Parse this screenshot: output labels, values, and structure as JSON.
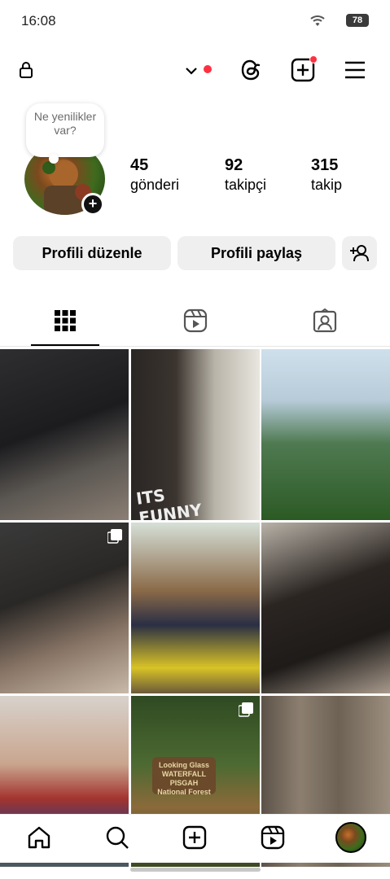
{
  "status_bar": {
    "time": "16:08",
    "battery": "78"
  },
  "top_bar": {
    "icons": [
      "lock-icon",
      "chevron-down-icon",
      "threads-icon",
      "create-icon",
      "menu-icon"
    ],
    "accent": "#ff3040"
  },
  "profile": {
    "note": "Ne yenilikler var?",
    "stats": [
      {
        "value": "45",
        "label": "gönderi"
      },
      {
        "value": "92",
        "label": "takipçi"
      },
      {
        "value": "315",
        "label": "takip"
      }
    ]
  },
  "buttons": {
    "edit": "Profili düzenle",
    "share": "Profili paylaş"
  },
  "tabs": [
    "grid-icon",
    "reels-icon",
    "tagged-icon"
  ],
  "grid": {
    "posts": [
      {
        "kind": "photo",
        "multi": false
      },
      {
        "kind": "photo",
        "multi": false,
        "text": "ITS FUNNY"
      },
      {
        "kind": "photo",
        "multi": false
      },
      {
        "kind": "photo",
        "multi": true
      },
      {
        "kind": "photo",
        "multi": false
      },
      {
        "kind": "photo",
        "multi": false
      },
      {
        "kind": "photo",
        "multi": false
      },
      {
        "kind": "photo",
        "multi": true,
        "sign": [
          "Looking Glass",
          "WATERFALL",
          "PISGAH",
          "National Forest"
        ]
      },
      {
        "kind": "photo",
        "multi": false
      }
    ]
  },
  "bottom_nav": [
    "home-icon",
    "search-icon",
    "create-icon",
    "reels-icon",
    "profile-avatar"
  ]
}
